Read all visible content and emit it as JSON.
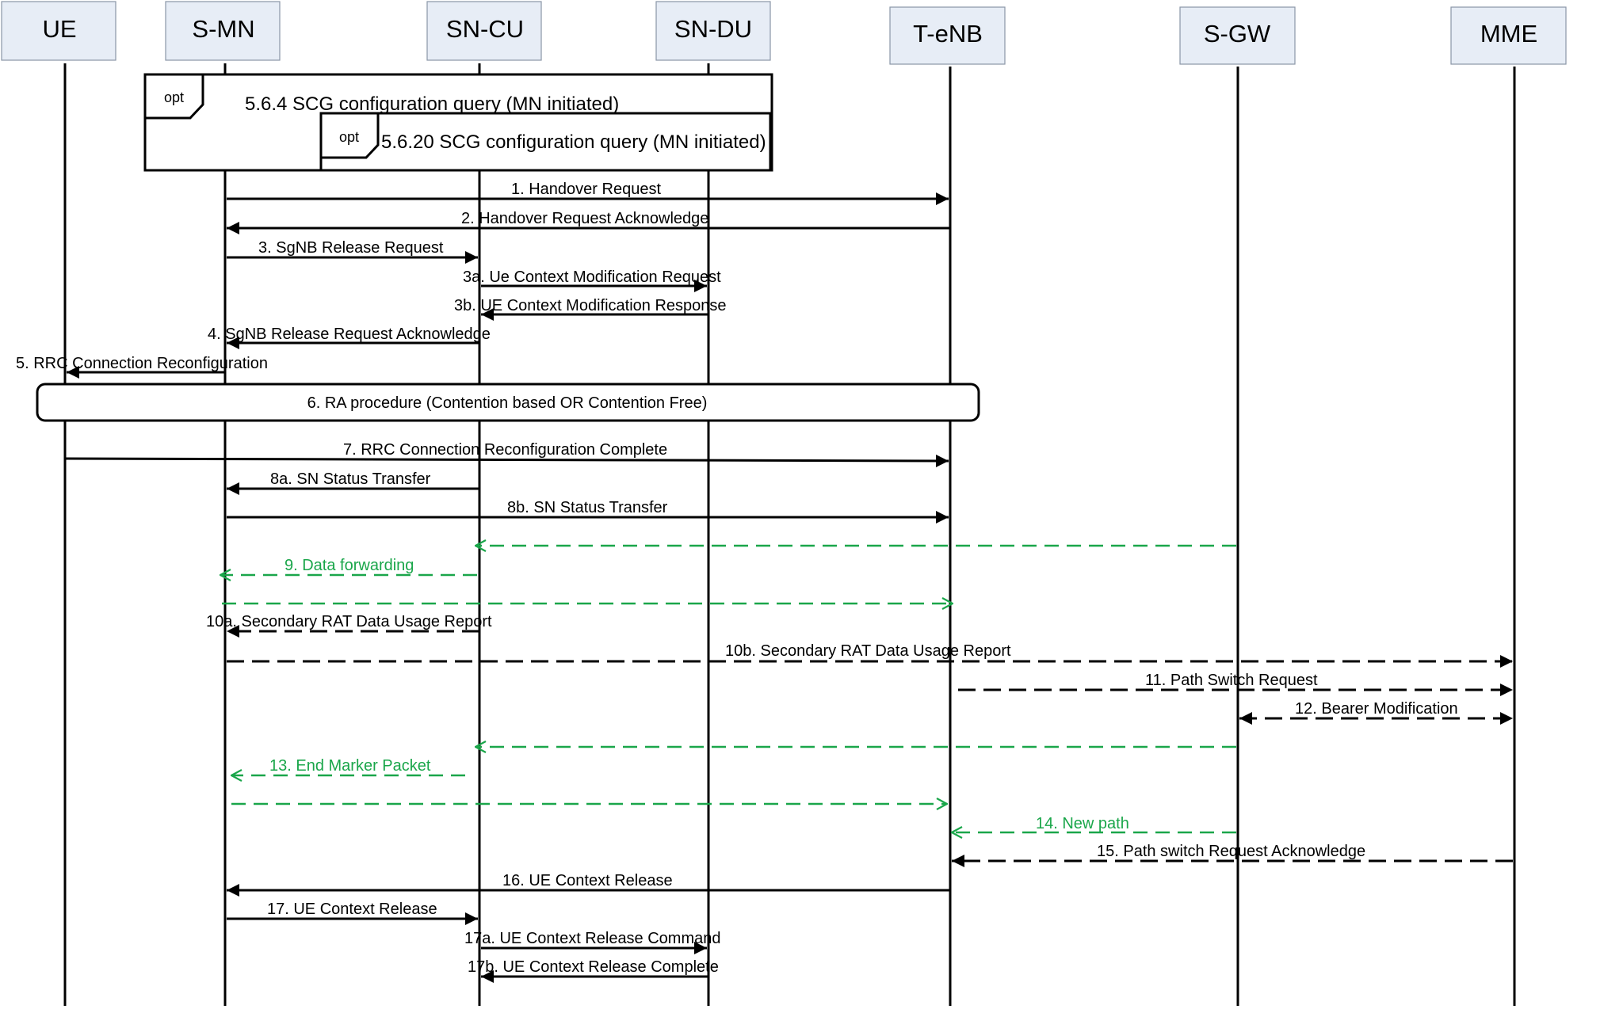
{
  "actors": {
    "ue": "UE",
    "smn": "S-MN",
    "sncu": "SN-CU",
    "sndu": "SN-DU",
    "tenb": "T-eNB",
    "sgw": "S-GW",
    "mme": "MME"
  },
  "frames": {
    "outer": {
      "tag": "opt",
      "title": "5.6.4 SCG configuration query (MN initiated)"
    },
    "inner": {
      "tag": "opt",
      "title": "5.6.20 SCG configuration query (MN initiated)"
    }
  },
  "messages": {
    "m1": "1. Handover Request",
    "m2": "2. Handover Request Acknowledge",
    "m3": "3. SgNB Release Request",
    "m3a": "3a. Ue Context Modification Request",
    "m3b": "3b. UE Context Modification Response",
    "m4": "4. SgNB Release Request Acknowledge",
    "m5": "5. RRC Connection Reconfiguration",
    "m6": "6. RA procedure (Contention based OR Contention Free)",
    "m7": "7. RRC Connection Reconfiguration Complete",
    "m8a": "8a. SN Status Transfer",
    "m8b": "8b. SN Status Transfer",
    "m9": "9. Data forwarding",
    "m10a": "10a. Secondary RAT Data Usage Report",
    "m10b": "10b. Secondary RAT Data Usage Report",
    "m11": "11. Path Switch Request",
    "m12": "12. Bearer Modification",
    "m13": "13. End Marker Packet",
    "m14": "14. New path",
    "m15": "15. Path switch Request Acknowledge",
    "m16": "16. UE Context Release",
    "m17": "17. UE Context Release",
    "m17a": "17a. UE Context Release Command",
    "m17b": "17b. UE Context Release Complete"
  },
  "colors": {
    "green": "#1aa64a",
    "black": "#000000",
    "actor_fill": "#e7edf6"
  }
}
